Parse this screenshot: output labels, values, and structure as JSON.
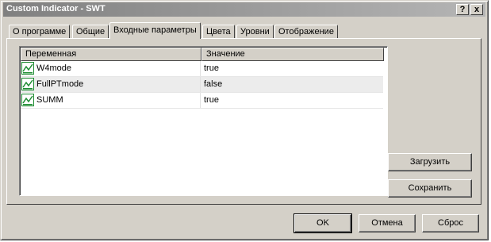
{
  "window": {
    "title": "Custom Indicator - SWT",
    "help_label": "?",
    "close_label": "x"
  },
  "tabs": [
    {
      "label": "О программе",
      "active": false
    },
    {
      "label": "Общие",
      "active": false
    },
    {
      "label": "Входные параметры",
      "active": true
    },
    {
      "label": "Цвета",
      "active": false
    },
    {
      "label": "Уровни",
      "active": false
    },
    {
      "label": "Отображение",
      "active": false
    }
  ],
  "params_table": {
    "columns": [
      "Переменная",
      "Значение"
    ],
    "rows": [
      {
        "name": "W4mode",
        "value": "true",
        "icon": "parameter-icon"
      },
      {
        "name": "FullPTmode",
        "value": "false",
        "icon": "parameter-icon"
      },
      {
        "name": "SUMM",
        "value": "true",
        "icon": "parameter-icon"
      }
    ]
  },
  "side_buttons": {
    "load_label": "Загрузить",
    "save_label": "Сохранить"
  },
  "footer_buttons": {
    "ok_label": "OK",
    "cancel_label": "Отмена",
    "reset_label": "Сброс"
  },
  "colors": {
    "titlebar_start": "#808080",
    "titlebar_end": "#b5b5b5",
    "icon_green": "#1e8c32"
  }
}
